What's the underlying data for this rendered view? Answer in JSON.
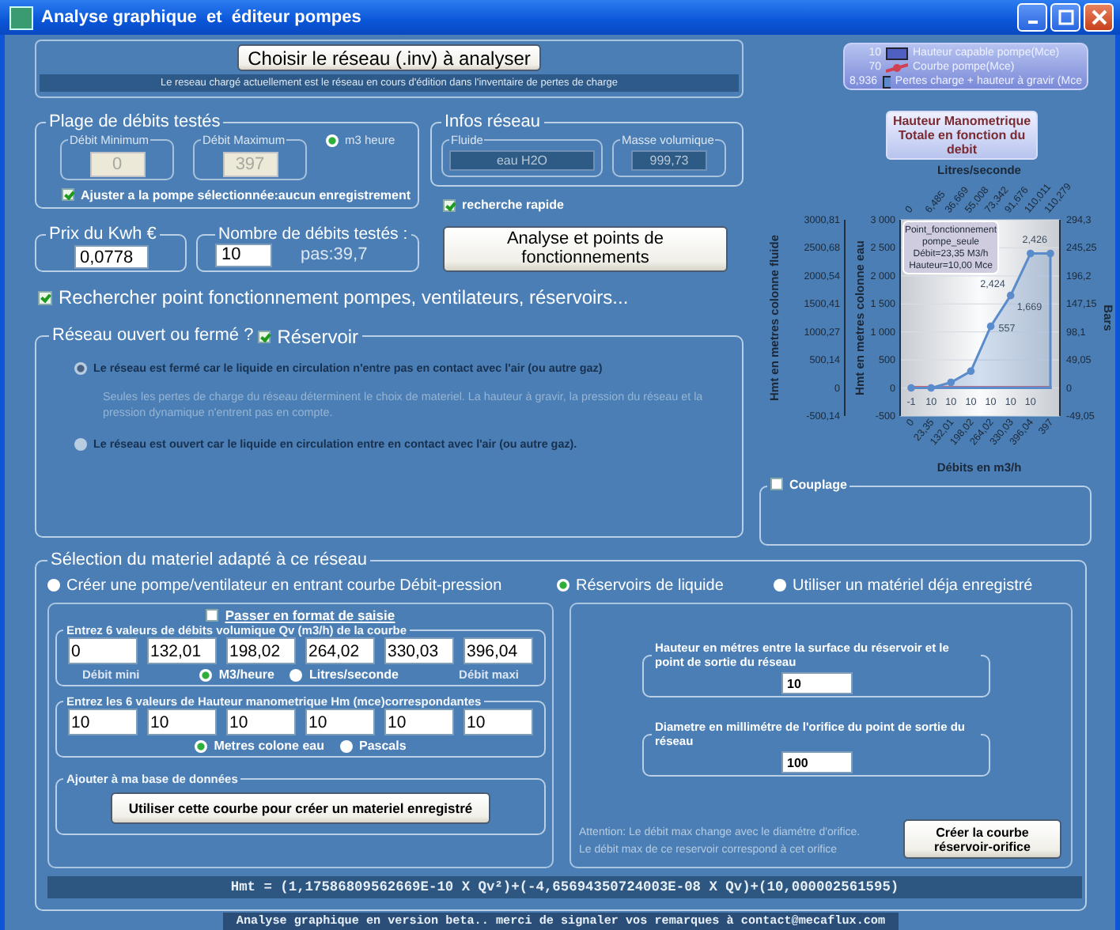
{
  "window": {
    "title": "Analyse graphique  et  éditeur pompes"
  },
  "network": {
    "choose_button": "Choisir le réseau (.inv) à analyser",
    "info": "Le reseau chargé actuellement est le réseau en cours d'édition dans l'inventaire de pertes de charge"
  },
  "flow_range": {
    "title": "Plage de débits testés",
    "min": {
      "label": "Débit Minimum",
      "value": "0",
      "disabled": true
    },
    "max": {
      "label": "Débit Maximum",
      "value": "397",
      "disabled": true
    },
    "unit": {
      "label": "m3 heure",
      "selected": true
    },
    "fit": {
      "label": "Ajuster a la pompe sélectionnée:aucun enregistrement",
      "checked": true
    }
  },
  "network_info": {
    "title": "Infos réseau",
    "fluid": {
      "label": "Fluide",
      "value": "eau H2O"
    },
    "density": {
      "label": "Masse volumique",
      "value": "999,73"
    }
  },
  "price": {
    "title": "Prix du Kwh €",
    "value": "0,0778"
  },
  "tested": {
    "title": "Nombre de débits testés :",
    "value": "10",
    "step": "pas:39,7"
  },
  "quick_search": {
    "label": "recherche rapide",
    "checked": true
  },
  "analyse_button": "Analyse et points de fonctionnements",
  "search_points": {
    "label": "Rechercher point fonctionnement pompes, ventilateurs, réservoirs...",
    "checked": true
  },
  "network_type": {
    "title": "Réseau ouvert ou fermé ?",
    "reservoir": {
      "label": "Réservoir",
      "checked": true
    },
    "options": [
      {
        "label": "Le réseau est fermé car le liquide en circulation n'entre pas en contact avec l'air (ou autre gaz)",
        "selected": true,
        "note": "Seules les pertes de charge du réseau déterminent le choix de materiel. La hauteur à gravir, la pression du réseau et  la pression dynamique n'entrent pas en compte."
      },
      {
        "label": "Le réseau est ouvert car le liquide en circulation entre en contact avec l'air (ou autre gaz).",
        "selected": false
      }
    ]
  },
  "chart": {
    "legend_values": [
      "10",
      "70",
      "8,936"
    ],
    "axes": {
      "outer_left": {
        "label": "Hmt en metres colonne fluide",
        "ticks": [
          "3000,81",
          "2500,68",
          "2000,54",
          "1500,41",
          "1000,27",
          "500,14",
          "0",
          "-500,14"
        ]
      },
      "right": {
        "label": "Bars",
        "ticks": [
          "294,3",
          "245,25",
          "196,2",
          "147,15",
          "98,1",
          "49,05",
          "0",
          "-49,05"
        ]
      },
      "top": {
        "label": "Litres/seconde",
        "ticks": [
          "0",
          "6,485",
          "36,669",
          "55,008",
          "73,342",
          "91,676",
          "110,011",
          "110,279"
        ]
      }
    },
    "tooltip": [
      "Point_fonctionnement",
      "pompe_seule",
      "Débit=23,35 M3/h",
      "Hauteur=10,00 Mce"
    ],
    "chart_data": {
      "type": "area",
      "title": "Hauteur Manometrique Totale en fonction du debit",
      "xlabel": "Débits en m3/h",
      "ylabel": "Hmt en metres colonne eau",
      "categories": [
        "0",
        "23,35",
        "132,01",
        "198,02",
        "264,02",
        "330,03",
        "396,04",
        "397"
      ],
      "series": [
        {
          "name": "Hauteur capable pompe(Mce)",
          "color": "#5060c0",
          "values": [
            null,
            null,
            null,
            null,
            null,
            null,
            null,
            null
          ]
        },
        {
          "name": "Courbe pompe(Mce)",
          "color": "#d04050",
          "values": [
            10,
            10,
            10,
            10,
            10,
            10,
            10,
            10
          ]
        },
        {
          "name": "Pertes charge + hauteur à gravir (Mce",
          "color": "#5a8ccc",
          "values": [
            0,
            0,
            100,
            300,
            1100,
            1650,
            2400,
            2400
          ],
          "marker": true
        }
      ],
      "grid": true,
      "ylim": [
        -500,
        3000
      ],
      "yticks": [
        {
          "value": 3000,
          "label": "3 000"
        },
        {
          "value": 2500,
          "label": "2 500"
        },
        {
          "value": 2000,
          "label": "2 000"
        },
        {
          "value": 1500,
          "label": "1 500"
        },
        {
          "value": 1000,
          "label": "1 000"
        },
        {
          "value": 500,
          "label": "500"
        },
        {
          "value": 0,
          "label": "0"
        },
        {
          "value": -500,
          "label": "-500"
        }
      ],
      "value_labels": [
        [
          null,
          null,
          null,
          null,
          null,
          null,
          null,
          null
        ],
        [
          "-1",
          "10",
          "10",
          "10",
          "10",
          "10",
          "10",
          null
        ],
        [
          null,
          null,
          null,
          null,
          "557",
          "1,669",
          "2,424",
          "2,426"
        ]
      ]
    }
  },
  "coupling": {
    "label": "Couplage",
    "checked": false
  },
  "selection": {
    "title": "Sélection du materiel adapté à ce réseau",
    "modes": [
      {
        "label": "Créer une pompe/ventilateur en entrant courbe Débit-pression",
        "selected": false
      },
      {
        "label": "Réservoirs de liquide",
        "selected": true
      },
      {
        "label": "Utiliser un matériel déja enregistré",
        "selected": false
      }
    ],
    "curve": {
      "format_toggle": {
        "label": "Passer en format de saisie",
        "checked": false
      },
      "flows": {
        "title": "Entrez 6 valeurs de débits volumique Qv (m3/h) de la courbe",
        "values": [
          "0",
          "132,01",
          "198,02",
          "264,02",
          "330,03",
          "396,04"
        ],
        "min_label": "Débit mini",
        "max_label": "Débit maxi",
        "units": [
          {
            "label": "M3/heure",
            "selected": true
          },
          {
            "label": "Litres/seconde",
            "selected": false
          }
        ]
      },
      "heads": {
        "title": "Entrez les 6 valeurs de Hauteur manometrique Hm (mce)correspondantes",
        "values": [
          "10",
          "10",
          "10",
          "10",
          "10",
          "10"
        ],
        "units": [
          {
            "label": "Metres colone eau",
            "selected": true
          },
          {
            "label": "Pascals",
            "selected": false
          }
        ]
      },
      "database": {
        "title": "Ajouter à ma base de données",
        "button": "Utiliser cette courbe pour créer un materiel enregistré"
      }
    },
    "reservoir": {
      "height": {
        "label": "Hauteur en métres entre la surface du réservoir et le point de sortie du réseau",
        "value": "10"
      },
      "diameter": {
        "label": "Diametre en millimétre de l'orifice du point de sortie du réseau",
        "value": "100"
      },
      "warning": [
        "Attention: Le débit max change avec le diamétre d'orifice.",
        "Le débit max de ce reservoir correspond à cet orifice"
      ],
      "button": "Créer la courbe réservoir-orifice"
    },
    "formula": "Hmt = (1,17586809562669E-10 X Qv²)+(-4,65694350724003E-08 X Qv)+(10,000002561595)"
  },
  "status": "Analyse graphique en version beta.. merci de signaler vos remarques à contact@mecaflux.com"
}
